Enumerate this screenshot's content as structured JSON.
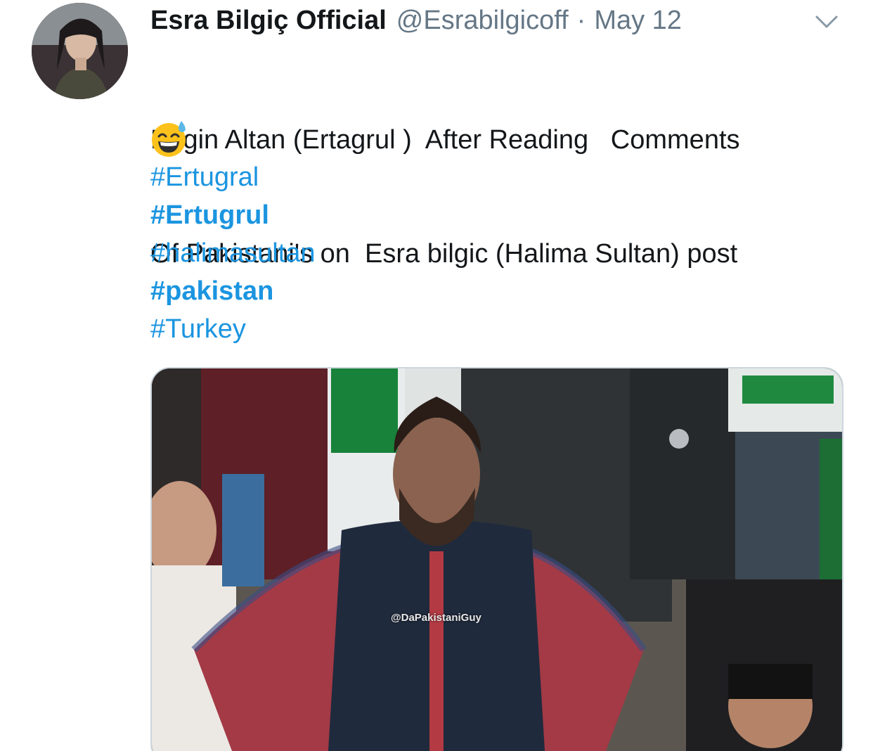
{
  "tweet": {
    "display_name": "Esra Bilgiç Official",
    "handle": "@Esrabilgicoff",
    "separator": "·",
    "date": "May 12",
    "text_line1": "Engin Altan (Ertagrul )  After Reading   Comments",
    "text_line2": "Of Pakistani's on  Esra bilgic (Halima Sultan) post",
    "emoji": "sweat-smile-emoji",
    "hashtags": [
      {
        "text": "#Ertugral",
        "bold": false
      },
      {
        "text": "#Ertugrul",
        "bold": true
      },
      {
        "text": "#halimasultan",
        "bold": false
      },
      {
        "text": "#pakistan",
        "bold": true
      },
      {
        "text": "#Turkey",
        "bold": false
      }
    ],
    "media_watermark": "@DaPakistaniGuy"
  },
  "colors": {
    "name": "#14171a",
    "secondary": "#657786",
    "hashtag": "#1b95e0",
    "media_border": "#ccd6dd"
  },
  "icons": {
    "caret": "chevron-down-icon"
  }
}
